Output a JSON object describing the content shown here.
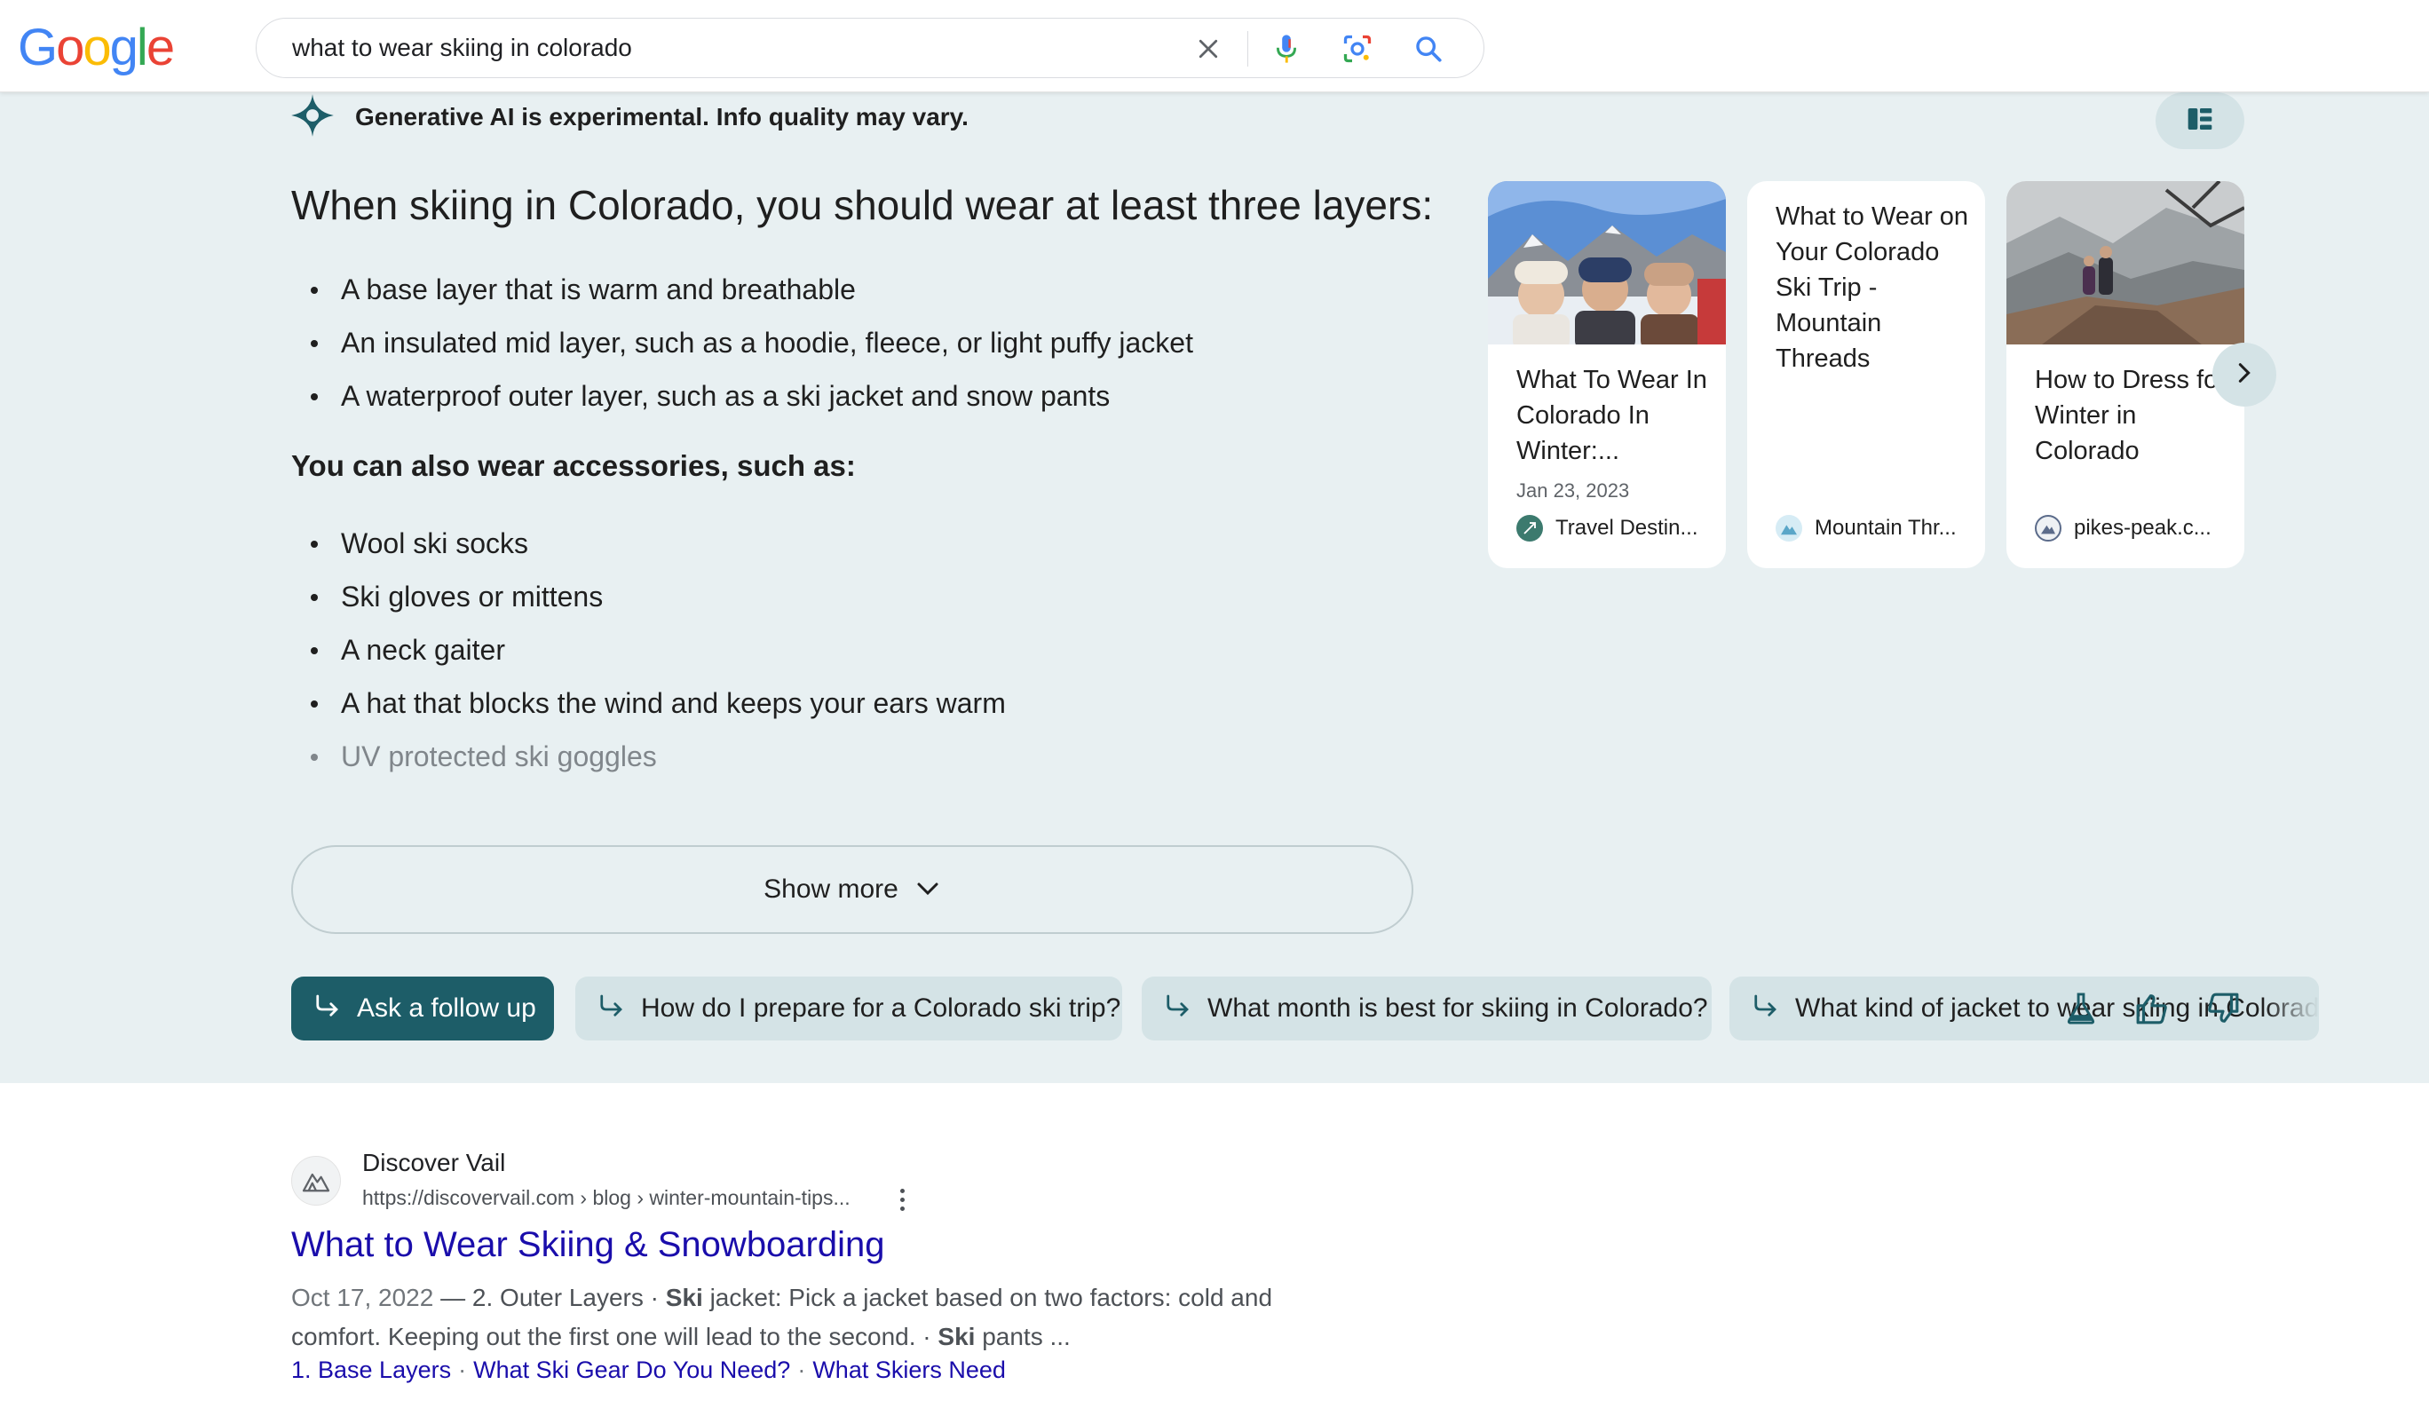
{
  "header": {
    "logo_letters": [
      {
        "ch": "G",
        "color": "#4285F4"
      },
      {
        "ch": "o",
        "color": "#EA4335"
      },
      {
        "ch": "o",
        "color": "#FBBC05"
      },
      {
        "ch": "g",
        "color": "#4285F4"
      },
      {
        "ch": "l",
        "color": "#34A853"
      },
      {
        "ch": "e",
        "color": "#EA4335"
      }
    ],
    "search_query": "what to wear skiing in colorado"
  },
  "ai_overview": {
    "badge_text": "Generative AI is experimental. Info quality may vary.",
    "heading": "When skiing in Colorado, you should wear at least three layers:",
    "layers": [
      "A base layer that is warm and breathable",
      "An insulated mid layer, such as a hoodie, fleece, or light puffy jacket",
      "A waterproof outer layer, such as a ski jacket and snow pants"
    ],
    "accessories_heading": "You can also wear accessories, such as:",
    "accessories": [
      "Wool ski socks",
      "Ski gloves or mittens",
      "A neck gaiter",
      "A hat that blocks the wind and keeps your ears warm",
      "UV protected ski goggles"
    ],
    "show_more_label": "Show more",
    "cards": [
      {
        "title": "What To Wear In Colorado In Winter:...",
        "date": "Jan 23, 2023",
        "source": "Travel Destin..."
      },
      {
        "title": "What to Wear on Your Colorado Ski Trip - Mountain Threads",
        "date": "",
        "source": "Mountain Thr..."
      },
      {
        "title": "How to Dress for Winter in Colorado",
        "date": "",
        "source": "pikes-peak.c..."
      }
    ],
    "ask_follow_up_label": "Ask a follow up",
    "follow_up_chips": [
      "How do I prepare for a Colorado ski trip?",
      "What month is best for skiing in Colorado?",
      "What kind of jacket to wear skiing in Colorado?"
    ]
  },
  "result": {
    "site_name": "Discover Vail",
    "url": "https://discovervail.com › blog › winter-mountain-tips...",
    "title": "What to Wear Skiing & Snowboarding",
    "snippet": {
      "date": "Oct 17, 2022",
      "part1": " — 2. Outer Layers · ",
      "bold1": "Ski",
      "part2": " jacket: Pick a jacket based on two factors: cold and comfort. Keeping out the first one will lead to the second. · ",
      "bold2": "Ski",
      "part3": " pants ..."
    },
    "sitelinks": [
      "1. Base Layers",
      "What Ski Gear Do You Need?",
      "What Skiers Need"
    ]
  },
  "colors": {
    "ai_background": "#e8f0f2",
    "accent": "#1d5d68",
    "link": "#1a0dab"
  }
}
